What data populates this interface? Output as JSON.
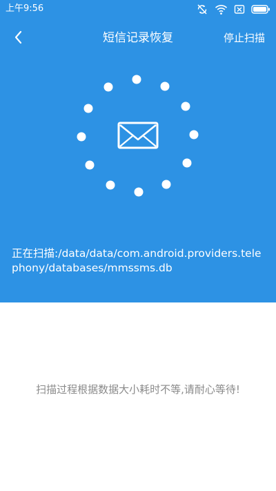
{
  "status_bar": {
    "time": "上午9:56",
    "icons": [
      "sync-off-icon",
      "wifi-icon",
      "sim-no-signal-icon",
      "battery-icon"
    ]
  },
  "header": {
    "back_icon": "chevron-left-icon",
    "title": "短信记录恢复",
    "stop_label": "停止扫描"
  },
  "scan": {
    "icon": "envelope-icon",
    "path_text": "正在扫描:/data/data/com.android.providers.telephony/databases/mmssms.db"
  },
  "hint": "扫描过程根据数据大小耗时不等,请耐心等待!",
  "colors": {
    "accent": "#2d92e4",
    "text_on_accent": "#ffffff",
    "hint_text": "#8a8a8a",
    "background": "#ffffff"
  }
}
